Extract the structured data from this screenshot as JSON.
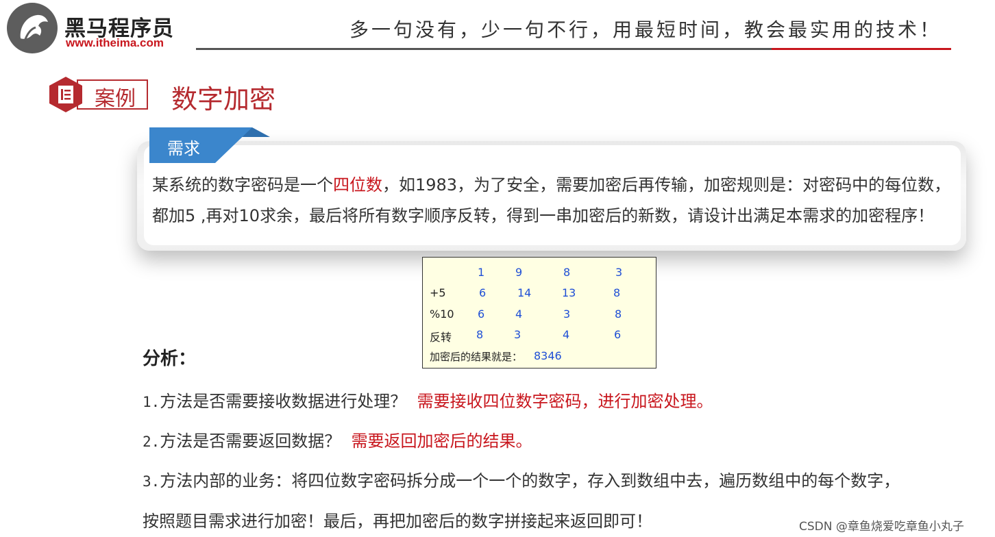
{
  "header": {
    "logo_name": "黑马程序员",
    "logo_url": "www.itheima.com",
    "slogan": "多一句没有，少一句不行，用最短时间，教会最实用的技术！"
  },
  "case": {
    "label": "案例",
    "title": "数字加密"
  },
  "requirement": {
    "tab": "需求",
    "line1_before": "某系统的数字密码是一个",
    "line1_highlight": "四位数",
    "line1_after": "，如1983，为了安全，需要加密后再传输，加密规则是：对密码中的每位数，",
    "line2": "都加5 ,再对10求余，最后将所有数字顺序反转，得到一串加密后的新数，请设计出满足本需求的加密程序！"
  },
  "example_table": {
    "rows": [
      {
        "label": "",
        "values": [
          "1",
          "9",
          "8",
          "3"
        ]
      },
      {
        "label": "+5",
        "values": [
          "6",
          "14",
          "13",
          "8"
        ]
      },
      {
        "label": "%10",
        "values": [
          "6",
          "4",
          "3",
          "8"
        ]
      },
      {
        "label": "反转",
        "values": [
          "8",
          "3",
          "4",
          "6"
        ]
      }
    ],
    "result_label": "加密后的结果就是：",
    "result_value": "8346"
  },
  "analysis": {
    "title": "分析：",
    "steps": [
      {
        "num": "1.",
        "text": "方法是否需要接收数据进行处理？",
        "answer": "需要接收四位数字密码，进行加密处理。"
      },
      {
        "num": "2.",
        "text": "方法是否需要返回数据？",
        "answer": "需要返回加密后的结果。"
      },
      {
        "num": "3.",
        "text": "方法内部的业务：将四位数字密码拆分成一个一个的数字，存入到数组中去，遍历数组中的每个数字，",
        "answer": ""
      }
    ],
    "continuation": "按照题目需求进行加密！最后，再把加密后的数字拼接起来返回即可！"
  },
  "watermark": "CSDN @章鱼烧爱吃章鱼小丸子",
  "colors": {
    "brand_red": "#c8161d",
    "case_red": "#b52a2f",
    "tab_blue": "#3b86cc",
    "table_bg": "#ffffe3",
    "table_blue": "#1f4fd6"
  }
}
